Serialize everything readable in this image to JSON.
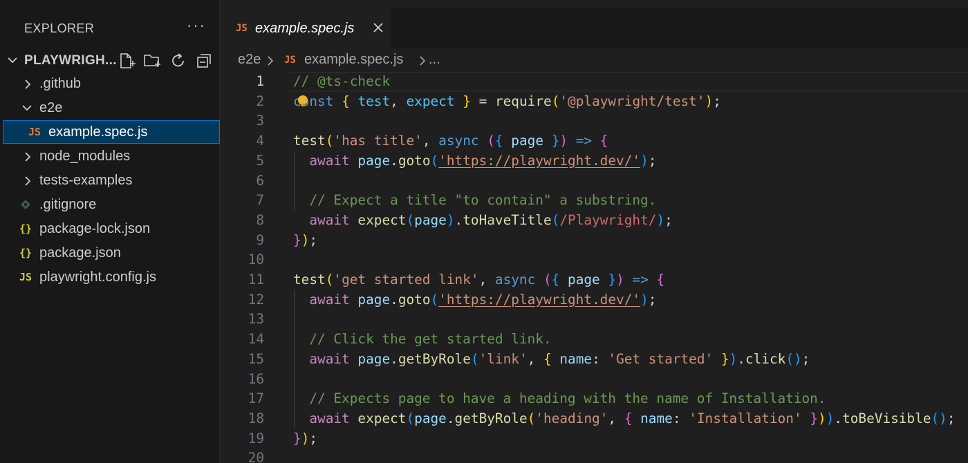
{
  "sidebar": {
    "title": "EXPLORER",
    "more": "···",
    "project_name": "PLAYWRIGH...",
    "tree": [
      {
        "label": ".github",
        "type": "folder",
        "expanded": false,
        "depth": 0
      },
      {
        "label": "e2e",
        "type": "folder",
        "expanded": true,
        "depth": 0
      },
      {
        "label": "example.spec.js",
        "type": "js",
        "icon": "JS",
        "depth": 1,
        "selected": true
      },
      {
        "label": "node_modules",
        "type": "folder",
        "expanded": false,
        "depth": 0
      },
      {
        "label": "tests-examples",
        "type": "folder",
        "expanded": false,
        "depth": 0
      },
      {
        "label": ".gitignore",
        "type": "git",
        "depth": 0
      },
      {
        "label": "package-lock.json",
        "type": "json",
        "icon": "{}",
        "depth": 0
      },
      {
        "label": "package.json",
        "type": "json",
        "icon": "{}",
        "depth": 0
      },
      {
        "label": "playwright.config.js",
        "type": "js",
        "icon": "JS",
        "depth": 0
      }
    ]
  },
  "editor": {
    "tab": {
      "icon": "JS",
      "label": "example.spec.js"
    },
    "breadcrumb": {
      "folder": "e2e",
      "file_icon": "JS",
      "file": "example.spec.js",
      "ellipsis": "..."
    },
    "active_line": 1,
    "lines": [
      [
        [
          "c-com",
          "// @ts-check"
        ]
      ],
      [
        [
          "c-kw",
          "const"
        ],
        [
          "c-punc",
          " "
        ],
        [
          "c-b1",
          "{"
        ],
        [
          "c-punc",
          " "
        ],
        [
          "c-cst",
          "test"
        ],
        [
          "c-punc",
          ", "
        ],
        [
          "c-cst",
          "expect"
        ],
        [
          "c-punc",
          " "
        ],
        [
          "c-b1",
          "}"
        ],
        [
          "c-punc",
          " = "
        ],
        [
          "c-fn",
          "require"
        ],
        [
          "c-b1",
          "("
        ],
        [
          "c-str",
          "'@playwright/test'"
        ],
        [
          "c-b1",
          ")"
        ],
        [
          "c-punc",
          ";"
        ]
      ],
      [],
      [
        [
          "c-fn",
          "test"
        ],
        [
          "c-b1",
          "("
        ],
        [
          "c-str",
          "'has title'"
        ],
        [
          "c-punc",
          ", "
        ],
        [
          "c-kw",
          "async"
        ],
        [
          "c-punc",
          " "
        ],
        [
          "c-b2",
          "("
        ],
        [
          "c-b3",
          "{"
        ],
        [
          "c-punc",
          " "
        ],
        [
          "c-var",
          "page"
        ],
        [
          "c-punc",
          " "
        ],
        [
          "c-b3",
          "}"
        ],
        [
          "c-b2",
          ")"
        ],
        [
          "c-punc",
          " "
        ],
        [
          "c-kw",
          "=>"
        ],
        [
          "c-punc",
          " "
        ],
        [
          "c-b2",
          "{"
        ]
      ],
      [
        [
          "c-punc",
          "  "
        ],
        [
          "c-ctl",
          "await"
        ],
        [
          "c-punc",
          " "
        ],
        [
          "c-var",
          "page"
        ],
        [
          "c-punc",
          "."
        ],
        [
          "c-fn",
          "goto"
        ],
        [
          "c-b3",
          "("
        ],
        [
          "c-str u",
          "'https://playwright.dev/'"
        ],
        [
          "c-b3",
          ")"
        ],
        [
          "c-punc",
          ";"
        ]
      ],
      [],
      [
        [
          "c-punc",
          "  "
        ],
        [
          "c-com",
          "// Expect a title \"to contain\" a substring."
        ]
      ],
      [
        [
          "c-punc",
          "  "
        ],
        [
          "c-ctl",
          "await"
        ],
        [
          "c-punc",
          " "
        ],
        [
          "c-fn",
          "expect"
        ],
        [
          "c-b3",
          "("
        ],
        [
          "c-var",
          "page"
        ],
        [
          "c-b3",
          ")"
        ],
        [
          "c-punc",
          "."
        ],
        [
          "c-fn",
          "toHaveTitle"
        ],
        [
          "c-b3",
          "("
        ],
        [
          "c-re",
          "/Playwright/"
        ],
        [
          "c-b3",
          ")"
        ],
        [
          "c-punc",
          ";"
        ]
      ],
      [
        [
          "c-b2",
          "}"
        ],
        [
          "c-b1",
          ")"
        ],
        [
          "c-punc",
          ";"
        ]
      ],
      [],
      [
        [
          "c-fn",
          "test"
        ],
        [
          "c-b1",
          "("
        ],
        [
          "c-str",
          "'get started link'"
        ],
        [
          "c-punc",
          ", "
        ],
        [
          "c-kw",
          "async"
        ],
        [
          "c-punc",
          " "
        ],
        [
          "c-b2",
          "("
        ],
        [
          "c-b3",
          "{"
        ],
        [
          "c-punc",
          " "
        ],
        [
          "c-var",
          "page"
        ],
        [
          "c-punc",
          " "
        ],
        [
          "c-b3",
          "}"
        ],
        [
          "c-b2",
          ")"
        ],
        [
          "c-punc",
          " "
        ],
        [
          "c-kw",
          "=>"
        ],
        [
          "c-punc",
          " "
        ],
        [
          "c-b2",
          "{"
        ]
      ],
      [
        [
          "c-punc",
          "  "
        ],
        [
          "c-ctl",
          "await"
        ],
        [
          "c-punc",
          " "
        ],
        [
          "c-var",
          "page"
        ],
        [
          "c-punc",
          "."
        ],
        [
          "c-fn",
          "goto"
        ],
        [
          "c-b3",
          "("
        ],
        [
          "c-str u",
          "'https://playwright.dev/'"
        ],
        [
          "c-b3",
          ")"
        ],
        [
          "c-punc",
          ";"
        ]
      ],
      [],
      [
        [
          "c-punc",
          "  "
        ],
        [
          "c-com",
          "// Click the get started link."
        ]
      ],
      [
        [
          "c-punc",
          "  "
        ],
        [
          "c-ctl",
          "await"
        ],
        [
          "c-punc",
          " "
        ],
        [
          "c-var",
          "page"
        ],
        [
          "c-punc",
          "."
        ],
        [
          "c-fn",
          "getByRole"
        ],
        [
          "c-b3",
          "("
        ],
        [
          "c-str",
          "'link'"
        ],
        [
          "c-punc",
          ", "
        ],
        [
          "c-b1",
          "{"
        ],
        [
          "c-punc",
          " "
        ],
        [
          "c-var",
          "name"
        ],
        [
          "c-punc",
          ": "
        ],
        [
          "c-str",
          "'Get started'"
        ],
        [
          "c-punc",
          " "
        ],
        [
          "c-b1",
          "}"
        ],
        [
          "c-b3",
          ")"
        ],
        [
          "c-punc",
          "."
        ],
        [
          "c-fn",
          "click"
        ],
        [
          "c-b3",
          "()"
        ],
        [
          "c-punc",
          ";"
        ]
      ],
      [],
      [
        [
          "c-punc",
          "  "
        ],
        [
          "c-com",
          "// Expects page to have a heading with the name of Installation."
        ]
      ],
      [
        [
          "c-punc",
          "  "
        ],
        [
          "c-ctl",
          "await"
        ],
        [
          "c-punc",
          " "
        ],
        [
          "c-fn",
          "expect"
        ],
        [
          "c-b3",
          "("
        ],
        [
          "c-var",
          "page"
        ],
        [
          "c-punc",
          "."
        ],
        [
          "c-fn",
          "getByRole"
        ],
        [
          "c-b1",
          "("
        ],
        [
          "c-str",
          "'heading'"
        ],
        [
          "c-punc",
          ", "
        ],
        [
          "c-b2",
          "{"
        ],
        [
          "c-punc",
          " "
        ],
        [
          "c-var",
          "name"
        ],
        [
          "c-punc",
          ": "
        ],
        [
          "c-str",
          "'Installation'"
        ],
        [
          "c-punc",
          " "
        ],
        [
          "c-b2",
          "}"
        ],
        [
          "c-b1",
          ")"
        ],
        [
          "c-b3",
          ")"
        ],
        [
          "c-punc",
          "."
        ],
        [
          "c-fn",
          "toBeVisible"
        ],
        [
          "c-b3",
          "()"
        ],
        [
          "c-punc",
          ";"
        ]
      ],
      [
        [
          "c-b2",
          "}"
        ],
        [
          "c-b1",
          ")"
        ],
        [
          "c-punc",
          ";"
        ]
      ],
      []
    ]
  },
  "colors": {
    "sidebar_bg": "#181818",
    "editor_bg": "#1f1f1f",
    "selection": "#04395e",
    "focus_border": "#0078d4",
    "js_icon": "#e37933",
    "json_icon": "#cbcb41"
  }
}
